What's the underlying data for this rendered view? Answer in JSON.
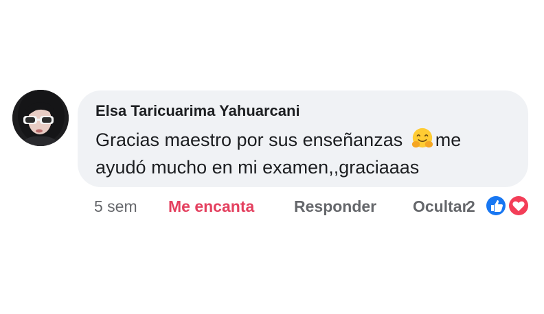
{
  "comment": {
    "author": "Elsa Taricuarima Yahuarcani",
    "text_line1_before_emoji": "Gracias maestro por sus enseñanzas ",
    "emoji": "hugging-face-emoji",
    "text_line1_after_emoji": "me",
    "text_line2": "ayudó mucho en mi examen,,graciaaas"
  },
  "actions": {
    "timestamp": "5 sem",
    "love_label": "Me encanta",
    "reply_label": "Responder",
    "hide_label": "Ocultar",
    "reaction_count": "2",
    "reaction_icons": [
      "like-icon",
      "love-icon"
    ]
  },
  "colors": {
    "bubble_bg": "#f0f2f5",
    "love_red": "#e4405f",
    "like_blue": "#1877f2",
    "secondary_text": "#65676b"
  }
}
